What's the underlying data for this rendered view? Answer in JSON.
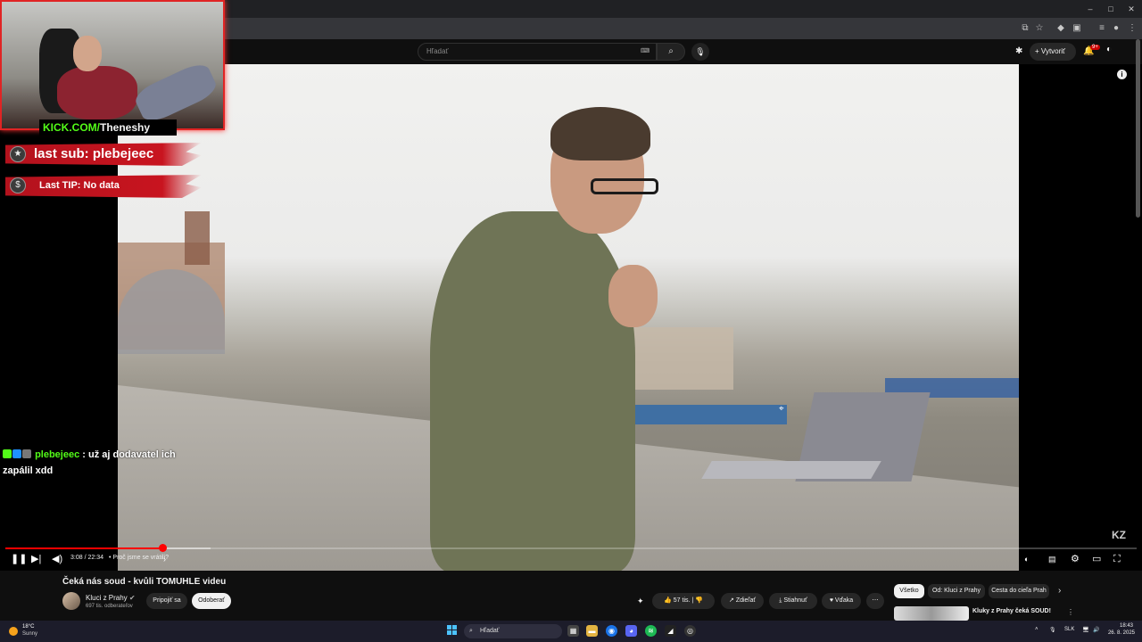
{
  "browser": {
    "window_controls": [
      "–",
      "□",
      "✕"
    ],
    "toolbar_icons": [
      "cast-icon",
      "star-icon",
      "extension-icon",
      "puzzle-icon",
      "media-icon",
      "profile-icon",
      "menu-icon"
    ]
  },
  "youtube_header": {
    "search_placeholder": "Hľadať",
    "create_label": "Vytvoriť",
    "notification_count": "9+"
  },
  "overlay": {
    "kick_prefix": "KICK.COM/",
    "kick_user": "Theneshy",
    "last_sub": "last sub: plebejeec",
    "last_tip": "Last TIP: No data",
    "chat_user": "plebejeec",
    "chat_message": " : už aj dodavatel ich zapálil xdd"
  },
  "player": {
    "time": "3:08 / 22:34",
    "chapter": "• Proč jsme se vrátili?",
    "progress_percent": 13.9,
    "watermark": "KZ"
  },
  "video_info": {
    "title": "Čeká nás soud - kvůli TOMUHLE videu",
    "channel": "Kluci z Prahy",
    "subscribers": "697 tis. odberateľov",
    "join_label": "Pripojiť sa",
    "subscribe_label": "Odoberať",
    "likes": "57 tis.",
    "share_label": "Zdieľať",
    "download_label": "Stiahnuť",
    "thanks_label": "Vďaka"
  },
  "related": {
    "chips": [
      "Všetko",
      "Od: Kluci z Prahy",
      "Cesta do cieľa Prah"
    ],
    "first_title": "Kluky z Prahy čeká SOUD!"
  },
  "taskbar": {
    "temperature": "18°C",
    "condition": "Sunny",
    "search": "Hľadať",
    "language": "SLK",
    "time": "18:43",
    "date": "26. 8. 2025"
  }
}
